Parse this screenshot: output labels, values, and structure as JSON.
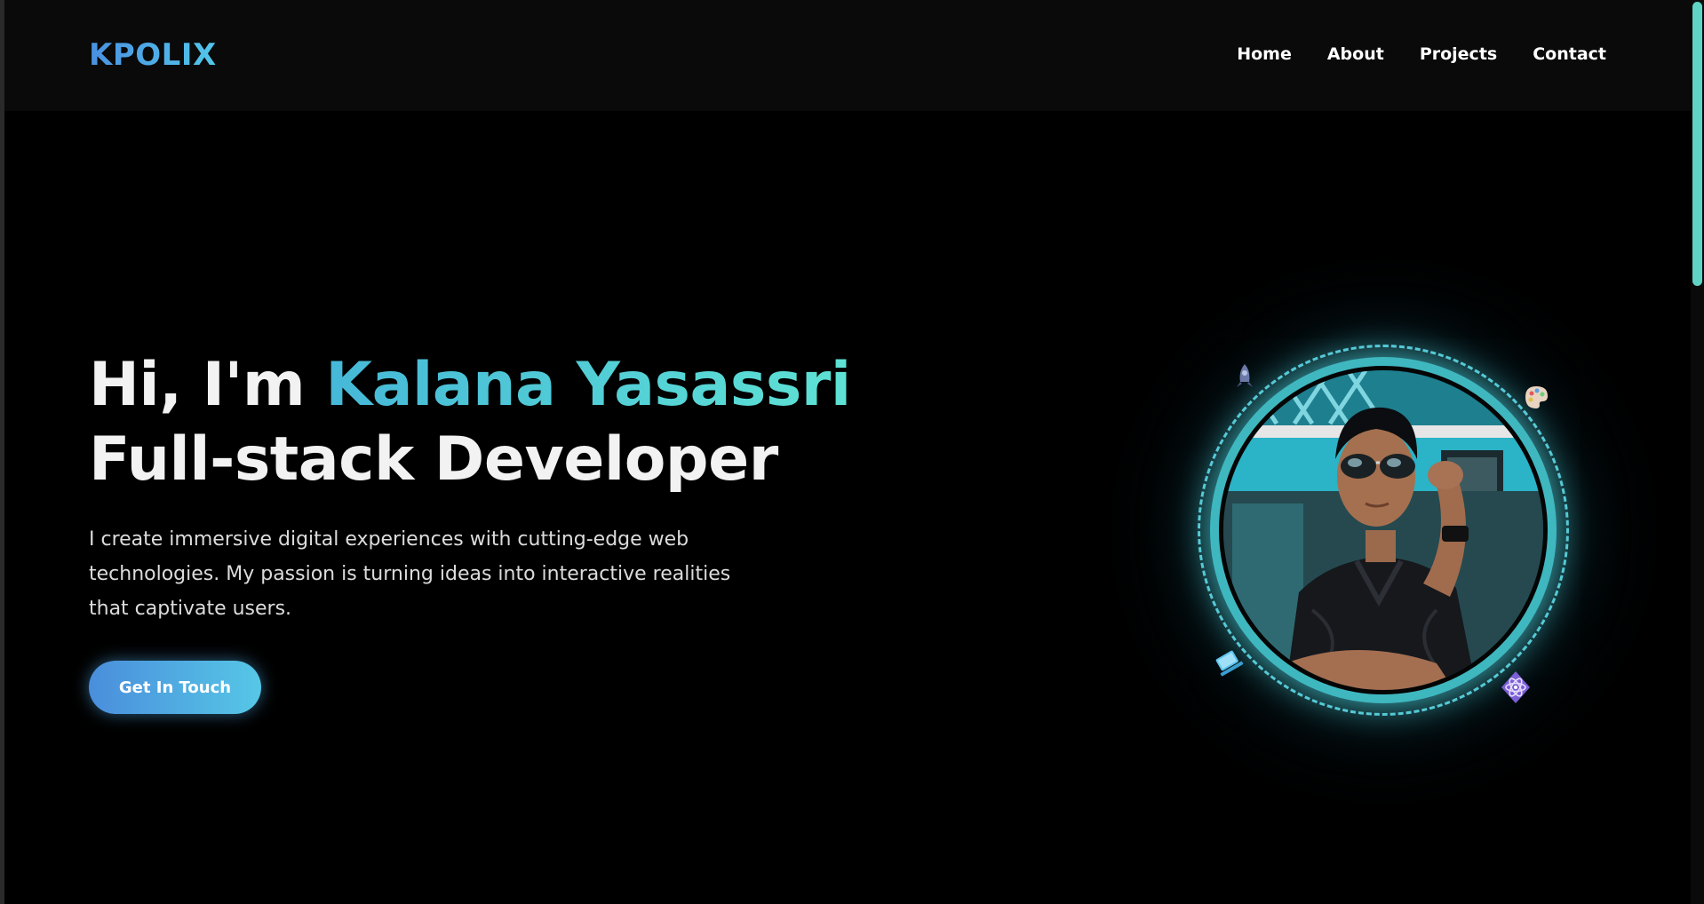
{
  "header": {
    "logo": "KPOLIX",
    "nav": [
      {
        "label": "Home"
      },
      {
        "label": "About"
      },
      {
        "label": "Projects"
      },
      {
        "label": "Contact"
      }
    ]
  },
  "hero": {
    "greeting": "Hi, I'm ",
    "name": "Kalana Yasassri",
    "role": "Full-stack Developer",
    "description": "I create immersive digital experiences with cutting-edge web technologies. My passion is turning ideas into interactive realities that captivate users.",
    "cta_label": "Get In Touch"
  },
  "profile": {
    "floating_icons": [
      "rocket-icon",
      "palette-icon",
      "laptop-icon",
      "react-atom-icon"
    ]
  },
  "colors": {
    "accent_blue": "#4a90e2",
    "accent_teal": "#5ee2d4",
    "ring": "#3fb7bf",
    "background": "#000000"
  }
}
